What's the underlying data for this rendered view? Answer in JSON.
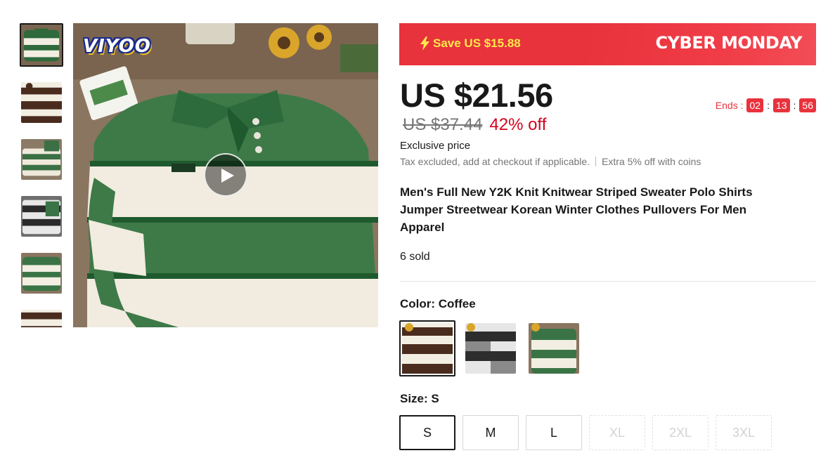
{
  "gallery": {
    "thumbnails": [
      {
        "name": "green-white",
        "colors": [
          "#2e6a3c",
          "#f2eee2"
        ]
      },
      {
        "name": "coffee",
        "colors": [
          "#4a2c1e",
          "#f2eee2"
        ]
      },
      {
        "name": "green-white-stack",
        "colors": [
          "#3b7045",
          "#efe9dc"
        ]
      },
      {
        "name": "black-grey",
        "colors": [
          "#2a2a2a",
          "#e8e8e8"
        ]
      },
      {
        "name": "green-white-flat",
        "colors": [
          "#3a7446",
          "#f2eee2"
        ]
      },
      {
        "name": "coffee-partial",
        "colors": [
          "#4a2c1e",
          "#f2eee2"
        ]
      }
    ],
    "brand_logo": "VIYOO",
    "play_icon": "play-icon"
  },
  "promo": {
    "save_text": "Save US $15.88",
    "event_text": "CYBER MONDAY",
    "bolt_icon": "lightning-bolt-icon",
    "bg_color": "#e8323c",
    "save_color": "#ffe94a"
  },
  "pricing": {
    "current_price": "US $21.56",
    "original_price": "US $37.44",
    "discount": "42% off",
    "exclusive": "Exclusive price",
    "tax_note": "Tax excluded, add at checkout if applicable.",
    "coins_note": "Extra 5% off with coins"
  },
  "countdown": {
    "label": "Ends :",
    "hours": "02",
    "minutes": "13",
    "seconds": "56",
    "separator": ":"
  },
  "product": {
    "title": "Men's Full New Y2K Knit Knitwear Striped Sweater Polo Shirts Jumper Streetwear Korean Winter Clothes Pullovers For Men Apparel",
    "sold": "6 sold"
  },
  "color": {
    "label": "Color: Coffee",
    "options": [
      {
        "name": "Coffee",
        "stripe": "#4a2c1e",
        "base": "#f2eee2",
        "selected": true
      },
      {
        "name": "Black",
        "stripe": "#2d2d2d",
        "base": "#e6e6e6",
        "selected": false
      },
      {
        "name": "Green",
        "stripe": "#3a7446",
        "base": "#f2eee2",
        "selected": false
      }
    ]
  },
  "size": {
    "label": "Size: S",
    "options": [
      {
        "label": "S",
        "state": "selected"
      },
      {
        "label": "M",
        "state": "available"
      },
      {
        "label": "L",
        "state": "available"
      },
      {
        "label": "XL",
        "state": "disabled"
      },
      {
        "label": "2XL",
        "state": "disabled"
      },
      {
        "label": "3XL",
        "state": "disabled"
      }
    ]
  }
}
